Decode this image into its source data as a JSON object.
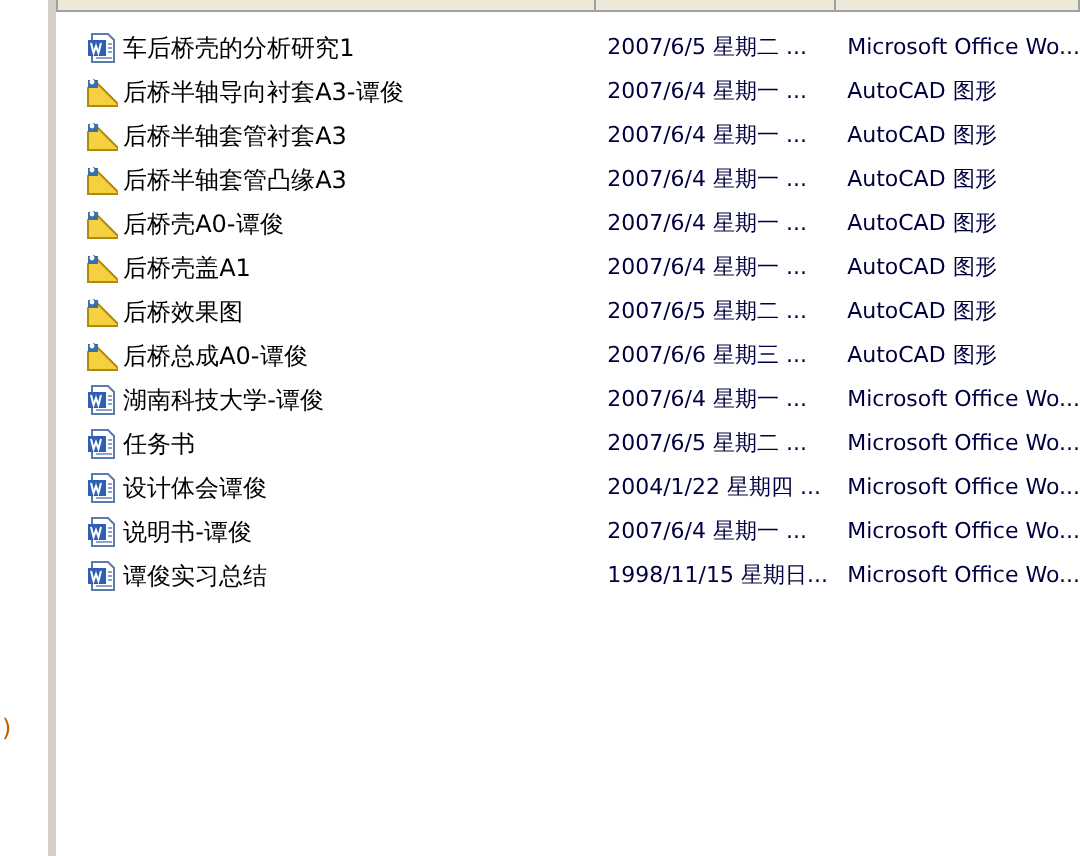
{
  "left_pane": {
    "text": ")"
  },
  "files": [
    {
      "kind": "word",
      "name": "车后桥壳的分析研究1",
      "date": "2007/6/5 星期二 ...",
      "type": "Microsoft Office Wo..."
    },
    {
      "kind": "cad",
      "name": "后桥半轴导向衬套A3-谭俊",
      "date": "2007/6/4 星期一 ...",
      "type": "AutoCAD 图形"
    },
    {
      "kind": "cad",
      "name": "后桥半轴套管衬套A3",
      "date": "2007/6/4 星期一 ...",
      "type": "AutoCAD 图形"
    },
    {
      "kind": "cad",
      "name": "后桥半轴套管凸缘A3",
      "date": "2007/6/4 星期一 ...",
      "type": "AutoCAD 图形"
    },
    {
      "kind": "cad",
      "name": "后桥壳A0-谭俊",
      "date": "2007/6/4 星期一 ...",
      "type": "AutoCAD 图形"
    },
    {
      "kind": "cad",
      "name": "后桥壳盖A1",
      "date": "2007/6/4 星期一 ...",
      "type": "AutoCAD 图形"
    },
    {
      "kind": "cad",
      "name": "后桥效果图",
      "date": "2007/6/5 星期二 ...",
      "type": "AutoCAD 图形"
    },
    {
      "kind": "cad",
      "name": "后桥总成A0-谭俊",
      "date": "2007/6/6 星期三 ...",
      "type": "AutoCAD 图形"
    },
    {
      "kind": "word",
      "name": "湖南科技大学-谭俊",
      "date": "2007/6/4 星期一 ...",
      "type": "Microsoft Office Wo..."
    },
    {
      "kind": "word",
      "name": "任务书",
      "date": "2007/6/5 星期二 ...",
      "type": "Microsoft Office Wo..."
    },
    {
      "kind": "word",
      "name": "设计体会谭俊",
      "date": "2004/1/22 星期四 ...",
      "type": "Microsoft Office Wo..."
    },
    {
      "kind": "word",
      "name": "说明书-谭俊",
      "date": "2007/6/4 星期一 ...",
      "type": "Microsoft Office Wo..."
    },
    {
      "kind": "word",
      "name": "谭俊实习总结",
      "date": "1998/11/15 星期日...",
      "type": "Microsoft Office Wo..."
    }
  ]
}
